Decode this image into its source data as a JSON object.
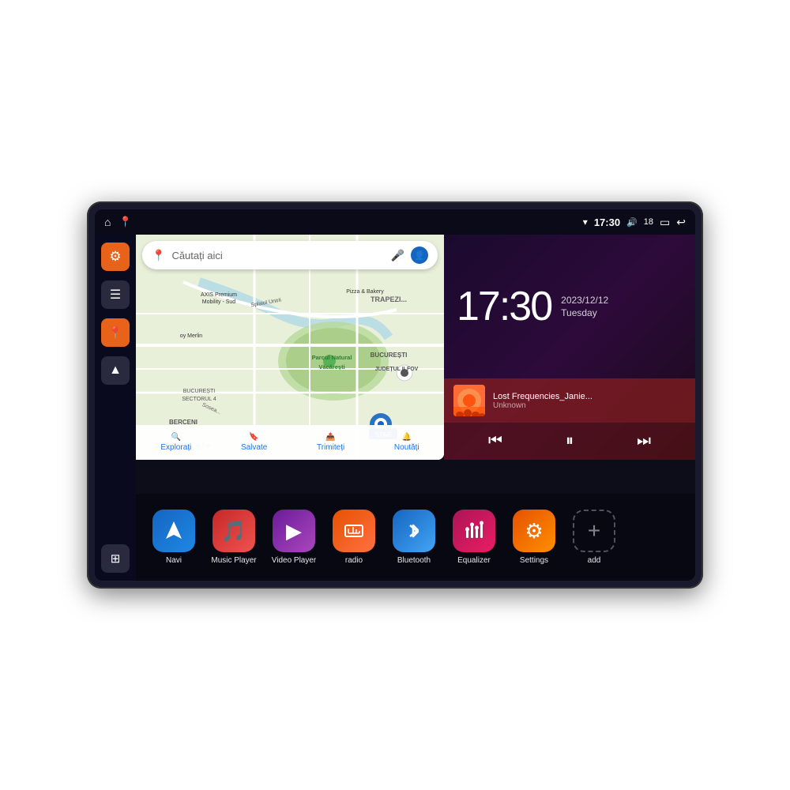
{
  "device": {
    "status_bar": {
      "home_icon": "⌂",
      "map_icon": "📍",
      "wifi_signal": "▾",
      "time": "17:30",
      "volume_icon": "🔊",
      "battery_level": "18",
      "battery_icon": "▭",
      "back_icon": "↩"
    },
    "sidebar": {
      "items": [
        {
          "label": "Settings",
          "icon": "⚙",
          "color": "orange"
        },
        {
          "label": "Files",
          "icon": "≡",
          "color": "dark"
        },
        {
          "label": "Map",
          "icon": "📍",
          "color": "orange"
        },
        {
          "label": "Navigation",
          "icon": "▲",
          "color": "dark"
        },
        {
          "label": "Grid",
          "icon": "⊞",
          "color": "dark"
        }
      ]
    },
    "map": {
      "search_placeholder": "Căutați aici",
      "location_label": "Parcul Natural Văcărești",
      "area_label1": "BUCUREȘTI",
      "area_label2": "JUDEȚUL ILFOV",
      "area_label3": "BUCUREȘTI SECTORUL 4",
      "area_label4": "BERCENI",
      "poi1": "AXIS Premium Mobility - Sud",
      "poi2": "Pizza & Bakery",
      "poi3": "oy Merlin",
      "nav_items": [
        {
          "label": "Explorați",
          "icon": "🔍"
        },
        {
          "label": "Salvate",
          "icon": "🔖"
        },
        {
          "label": "Trimiteți",
          "icon": "📤"
        },
        {
          "label": "Noutăți",
          "icon": "🔔"
        }
      ]
    },
    "clock": {
      "time": "17:30",
      "date": "2023/12/12",
      "day": "Tuesday"
    },
    "music": {
      "title": "Lost Frequencies_Janie...",
      "artist": "Unknown",
      "prev_icon": "⏮",
      "pause_icon": "⏸",
      "next_icon": "⏭"
    },
    "apps": [
      {
        "label": "Navi",
        "icon": "▲",
        "style": "navi"
      },
      {
        "label": "Music Player",
        "icon": "🎵",
        "style": "music"
      },
      {
        "label": "Video Player",
        "icon": "▶",
        "style": "video"
      },
      {
        "label": "radio",
        "icon": "📻",
        "style": "radio"
      },
      {
        "label": "Bluetooth",
        "icon": "⚡",
        "style": "bluetooth"
      },
      {
        "label": "Equalizer",
        "icon": "🎚",
        "style": "equalizer"
      },
      {
        "label": "Settings",
        "icon": "⚙",
        "style": "settings"
      },
      {
        "label": "add",
        "icon": "+",
        "style": "add"
      }
    ]
  }
}
